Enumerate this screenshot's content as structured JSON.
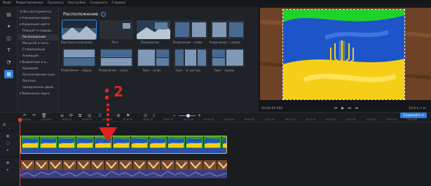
{
  "menu": [
    "Файл",
    "Редактирование",
    "Просмотр",
    "Настройки",
    "Сохранить",
    "Справка"
  ],
  "sidebar": {
    "items": [
      {
        "label": "☰ Все инструменты"
      },
      {
        "label": "▾ Улучшение видео"
      },
      {
        "label": "▾ Коррекция цвета"
      },
      {
        "label": "Поворот и кадрир..."
      },
      {
        "label": "Расположение"
      },
      {
        "label": "Масштаб и пано..."
      },
      {
        "label": "Стабилизация"
      },
      {
        "label": "Анимация"
      },
      {
        "label": "▾ Выделение и ц..."
      },
      {
        "label": "Хромакей"
      },
      {
        "label": "Распознавание сцен"
      },
      {
        "label": "Логотип"
      },
      {
        "label": "Замедленное движ..."
      },
      {
        "label": "▾ Изменение звука"
      }
    ]
  },
  "panel": {
    "title": "Расположение",
    "info_icon": "i",
    "tiles": [
      {
        "label": "Картинка в картинке"
      },
      {
        "label": "Лого"
      },
      {
        "label": "Перекрытие"
      },
      {
        "label": "Разделение – слева"
      },
      {
        "label": "Разделение – справа"
      },
      {
        "label": "Разделение – сверху"
      },
      {
        "label": "Разделение – снизу"
      },
      {
        "label": "Трио – слева"
      },
      {
        "label": "Трио – по центру"
      },
      {
        "label": "Трио – справа"
      }
    ]
  },
  "preview": {
    "timecode": "00:00:00.000",
    "transport": "⏮ ▶ ⏭ ⏭",
    "zoom": "16:9 ▾  ⤢  ⊡"
  },
  "toolbar": {
    "save_label": "Сохранить ▾"
  },
  "ruler": [
    "00:00:00",
    "00:00:05",
    "00:00:10",
    "00:00:15",
    "00:00:20",
    "00:00:25",
    "00:00:30",
    "00:00:35",
    "00:00:40",
    "00:00:45",
    "00:00:50",
    "00:00:55",
    "00:01:00",
    "00:01:05",
    "00:01:10",
    "00:01:15",
    "00:01:20",
    "00:01:25",
    "00:01:30",
    "00:01:35"
  ],
  "annotation": {
    "step": "2"
  },
  "colors": {
    "accent": "#2f7fe0",
    "chroma_green": "#1fd12b",
    "annotation_red": "#e02222",
    "clip_border": "#d8c23a"
  }
}
